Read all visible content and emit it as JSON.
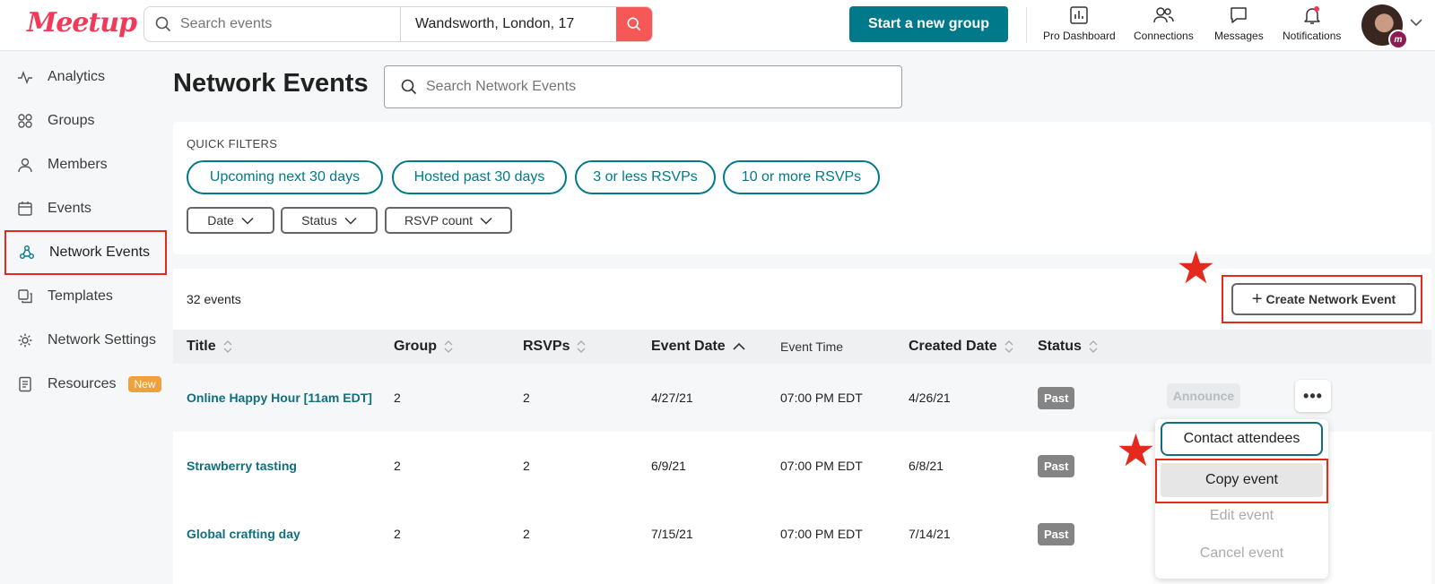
{
  "header": {
    "logo": "Meetup",
    "search_placeholder": "Search events",
    "location": "Wandsworth, London, 17",
    "start_group": "Start a new group",
    "nav": [
      {
        "label": "Pro Dashboard",
        "icon": "bar-chart-icon"
      },
      {
        "label": "Connections",
        "icon": "people-icon"
      },
      {
        "label": "Messages",
        "icon": "chat-icon"
      },
      {
        "label": "Notifications",
        "icon": "bell-icon"
      }
    ]
  },
  "sidebar": {
    "items": [
      {
        "label": "Analytics",
        "icon": "pulse-icon"
      },
      {
        "label": "Groups",
        "icon": "grid-icon"
      },
      {
        "label": "Members",
        "icon": "person-icon"
      },
      {
        "label": "Events",
        "icon": "calendar-icon"
      },
      {
        "label": "Network Events",
        "icon": "network-icon"
      },
      {
        "label": "Templates",
        "icon": "copy-icon"
      },
      {
        "label": "Network Settings",
        "icon": "gear-icon"
      },
      {
        "label": "Resources",
        "icon": "document-icon",
        "badge": "New"
      }
    ],
    "active": "Network Events"
  },
  "main": {
    "title": "Network Events",
    "search_placeholder": "Search Network Events",
    "quick_filters_label": "QUICK FILTERS",
    "quick_filters": [
      "Upcoming next 30 days",
      "Hosted past 30 days",
      "3 or less RSVPs",
      "10 or more RSVPs"
    ],
    "dropdowns": [
      "Date",
      "Status",
      "RSVP count"
    ],
    "count": "32 events",
    "create_button": "Create Network Event",
    "columns": [
      "Title",
      "Group",
      "RSVPs",
      "Event Date",
      "Event Time",
      "Created Date",
      "Status"
    ],
    "rows": [
      {
        "title": "Online Happy Hour [11am EDT]",
        "group": "2",
        "rsvps": "2",
        "event_date": "4/27/21",
        "event_time": "07:00 PM EDT",
        "created": "4/26/21",
        "status": "Past"
      },
      {
        "title": "Strawberry tasting",
        "group": "2",
        "rsvps": "2",
        "event_date": "6/9/21",
        "event_time": "07:00 PM EDT",
        "created": "6/8/21",
        "status": "Past"
      },
      {
        "title": "Global crafting day",
        "group": "2",
        "rsvps": "2",
        "event_date": "7/15/21",
        "event_time": "07:00 PM EDT",
        "created": "7/14/21",
        "status": "Past"
      }
    ],
    "announce": "Announce",
    "menu": [
      "Contact attendees",
      "Copy event",
      "Edit event",
      "Cancel event"
    ]
  },
  "colors": {
    "brand": "#f13a59",
    "teal": "#00798a",
    "annotation": "#e42a1d"
  }
}
